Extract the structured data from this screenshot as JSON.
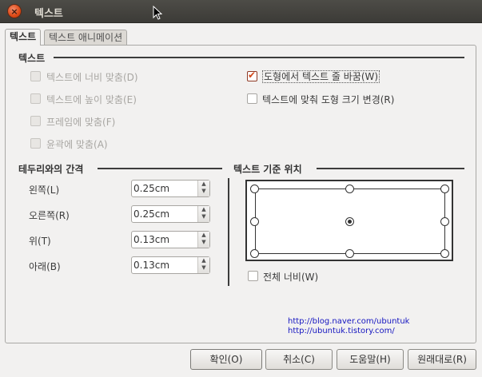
{
  "window": {
    "title": "텍스트",
    "close_icon": "close-icon"
  },
  "tabs": [
    {
      "label": "텍스트",
      "active": true
    },
    {
      "label": "텍스트 애니메이션",
      "active": false
    }
  ],
  "text_section": {
    "title": "텍스트",
    "left_options": [
      {
        "label": "텍스트에 너비 맞춤(D)",
        "checked": false,
        "enabled": false
      },
      {
        "label": "텍스트에 높이 맞춤(E)",
        "checked": false,
        "enabled": false
      },
      {
        "label": "프레임에 맞춤(F)",
        "checked": false,
        "enabled": false
      },
      {
        "label": "윤곽에 맞춤(A)",
        "checked": false,
        "enabled": false
      }
    ],
    "right_options": [
      {
        "label": "도형에서 텍스트 줄 바꿈(W)",
        "checked": true,
        "enabled": true
      },
      {
        "label": "텍스트에 맞춰 도형 크기 변경(R)",
        "checked": false,
        "enabled": true
      }
    ]
  },
  "spacing_section": {
    "title": "테두리와의 간격",
    "fields": [
      {
        "label": "왼쪽(L)",
        "value": "0.25cm"
      },
      {
        "label": "오른쪽(R)",
        "value": "0.25cm"
      },
      {
        "label": "위(T)",
        "value": "0.13cm"
      },
      {
        "label": "아래(B)",
        "value": "0.13cm"
      }
    ]
  },
  "anchor_section": {
    "title": "텍스트 기준 위치",
    "selected": "center",
    "full_width_label": "전체 너비(W)",
    "full_width_checked": false
  },
  "watermark": [
    "http://blog.naver.com/ubuntuk",
    "http://ubuntuk.tistory.com/"
  ],
  "buttons": {
    "ok": "확인(O)",
    "cancel": "취소(C)",
    "help": "도움말(H)",
    "reset": "원래대로(R)"
  }
}
